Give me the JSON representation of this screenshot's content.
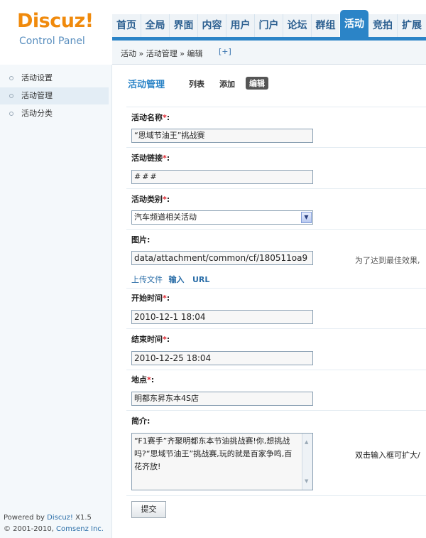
{
  "logo": {
    "brand_a": "Discuz",
    "brand_b": "!",
    "subtitle": "Control Panel"
  },
  "nav": {
    "items": [
      "首页",
      "全局",
      "界面",
      "内容",
      "用户",
      "门户",
      "论坛",
      "群组",
      "活动",
      "竞拍",
      "扩展"
    ],
    "active": "活动"
  },
  "breadcrumb": {
    "text": "活动 » 活动管理 » 编辑",
    "add": "[+]"
  },
  "sidebar": {
    "items": [
      "活动设置",
      "活动管理",
      "活动分类"
    ],
    "active": "活动管理",
    "powered_prefix": "Powered by ",
    "powered_brand": "Discuz!",
    "powered_version": " X1.5",
    "copyright_prefix": "© 2001-2010, ",
    "copyright_brand": "Comsenz Inc."
  },
  "main": {
    "title": "活动管理",
    "tabs": [
      "列表",
      "添加",
      "编辑"
    ],
    "active_tab": "编辑"
  },
  "form": {
    "name_label": "活动名称",
    "name_value": "“思域节油王”挑战赛",
    "link_label": "活动链接",
    "link_value": "###",
    "type_label": "活动类别",
    "type_value": "汽车频道相关活动",
    "image_label": "图片:",
    "image_value": "data/attachment/common/cf/180511oa9",
    "image_hint": "为了达到最佳效果,",
    "upload_file": "上传文件",
    "upload_input": "输入",
    "upload_url": "URL",
    "start_label": "开始时间",
    "start_value": "2010-12-1 18:04",
    "end_label": "结束时间",
    "end_value": "2010-12-25 18:04",
    "place_label": "地点",
    "place_value": "明都东昇东本4S店",
    "intro_label": "简介:",
    "intro_value": "“F1赛手”齐聚明都东本节油挑战赛!你,想挑战吗?“思域节油王”挑战赛,玩的就是百家争鸣,百花齐放!",
    "intro_hint": "双击输入框可扩大/",
    "required_mark": "*",
    "colon": ":",
    "submit": "提交"
  },
  "colors": {
    "accent": "#2b84c7",
    "logo_orange": "#f08a0c",
    "required": "#e0242e"
  }
}
